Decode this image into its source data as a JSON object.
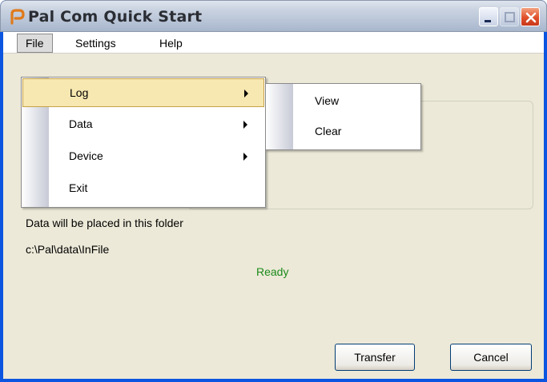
{
  "window": {
    "title": "Pal Com Quick Start"
  },
  "titlebar": {
    "minimize_icon": "minimize-icon",
    "maximize_icon": "maximize-icon",
    "close_icon": "close-icon",
    "app_icon": "palcom-app-icon"
  },
  "menubar": {
    "items": [
      {
        "label": "File"
      },
      {
        "label": "Settings"
      },
      {
        "label": "Help"
      }
    ]
  },
  "file_menu": {
    "items": [
      {
        "label": "Log",
        "has_submenu": true,
        "highlighted": true
      },
      {
        "label": "Data",
        "has_submenu": true
      },
      {
        "label": "Device",
        "has_submenu": true
      },
      {
        "label": "Exit",
        "has_submenu": false
      }
    ]
  },
  "log_submenu": {
    "items": [
      {
        "label": "View"
      },
      {
        "label": "Clear"
      }
    ]
  },
  "main": {
    "folder_label": "Data will be placed in this folder",
    "folder_path": "c:\\Pal\\data\\InFile",
    "status": "Ready"
  },
  "buttons": {
    "transfer": "Transfer",
    "cancel": "Cancel"
  },
  "colors": {
    "status_green": "#1a8a1a",
    "highlight": "#f7e7b0",
    "close_red": "#e0502a"
  }
}
